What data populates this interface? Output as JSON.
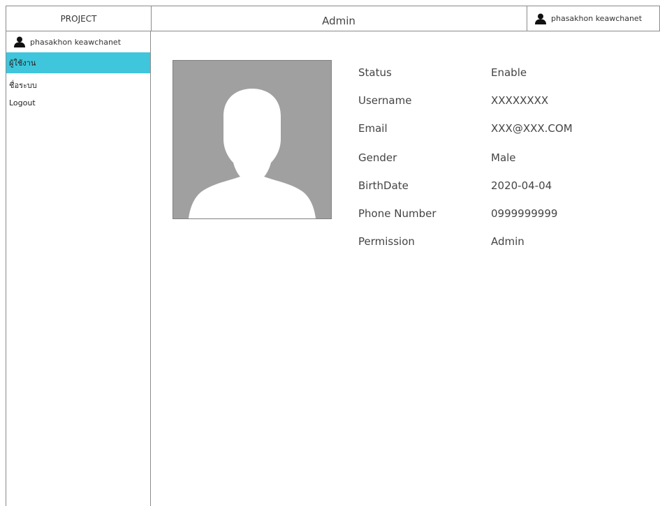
{
  "app": {
    "brand": "PROJECT"
  },
  "header": {
    "title": "Admin",
    "user_name": "phasakhon keawchanet"
  },
  "sidebar": {
    "user_name": "phasakhon keawchanet",
    "items": [
      {
        "label": "ผู้ใช้งาน",
        "active": true
      },
      {
        "label": "ชื่อระบบ",
        "active": false
      },
      {
        "label": "Logout",
        "active": false
      }
    ]
  },
  "profile": {
    "avatar_icon": "user-silhouette-icon",
    "fields": [
      {
        "label": "Status",
        "value": "Enable"
      },
      {
        "label": "Username",
        "value": "XXXXXXXX"
      },
      {
        "label": "Email",
        "value": "XXX@XXX.COM"
      },
      {
        "label": "Gender",
        "value": "Male"
      },
      {
        "label": "BirthDate",
        "value": "2020-04-04"
      },
      {
        "label": "Phone Number",
        "value": "0999999999"
      },
      {
        "label": "Permission",
        "value": "Admin"
      }
    ]
  },
  "colors": {
    "active_nav": "#3fc6dc",
    "avatar_bg": "#a0a0a0"
  }
}
